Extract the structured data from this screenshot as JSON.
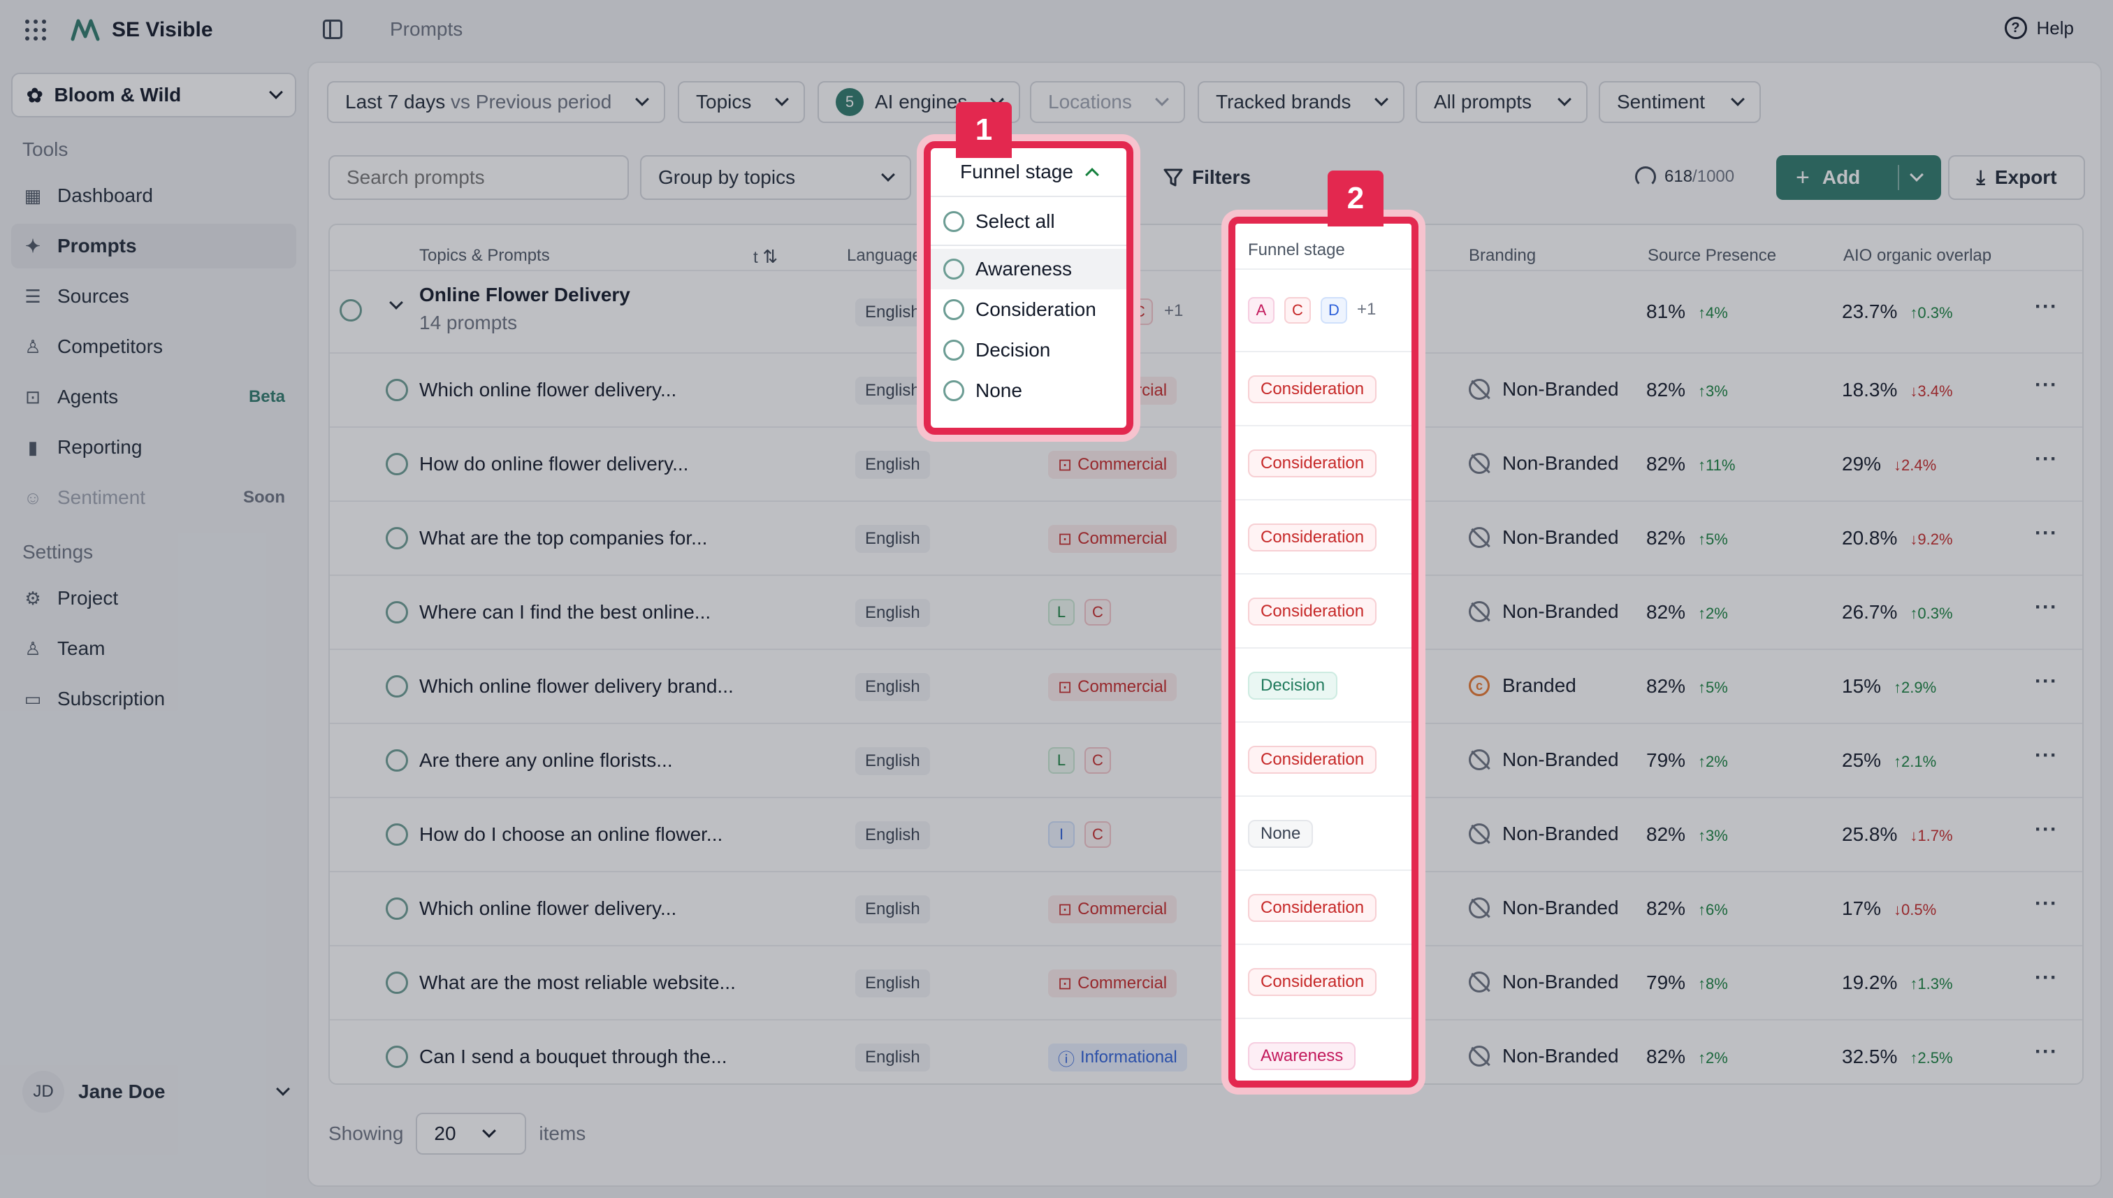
{
  "app": {
    "title": "SE Visible",
    "breadcrumb": "Prompts",
    "help": "Help"
  },
  "sidebar": {
    "workspace": "Bloom & Wild",
    "tools_label": "Tools",
    "settings_label": "Settings",
    "tools": [
      {
        "label": "Dashboard",
        "icon": "grid-icon"
      },
      {
        "label": "Prompts",
        "icon": "sparkle-icon",
        "active": true
      },
      {
        "label": "Sources",
        "icon": "list-icon"
      },
      {
        "label": "Competitors",
        "icon": "user-icon"
      },
      {
        "label": "Agents",
        "icon": "robot-icon",
        "badge": "Beta"
      },
      {
        "label": "Reporting",
        "icon": "bar-chart-icon"
      },
      {
        "label": "Sentiment",
        "icon": "smile-icon",
        "badge": "Soon"
      }
    ],
    "settings": [
      {
        "label": "Project",
        "icon": "gear-icon"
      },
      {
        "label": "Team",
        "icon": "users-icon"
      },
      {
        "label": "Subscription",
        "icon": "card-icon"
      }
    ],
    "user": {
      "initials": "JD",
      "name": "Jane Doe"
    }
  },
  "filters": {
    "period": "Last 7 days",
    "period_compare": "vs Previous period",
    "topics": "Topics",
    "engines_count": "5",
    "engines": "AI engines",
    "locations": "Locations",
    "tracked_brands": "Tracked brands",
    "all_prompts": "All prompts",
    "sentiment": "Sentiment"
  },
  "toolbar": {
    "search_placeholder": "Search prompts",
    "group_by": "Group by topics",
    "funnel_stage": "Funnel stage",
    "filters": "Filters",
    "quota_used": "618",
    "quota_max": "/1000",
    "add": "Add",
    "export": "Export"
  },
  "dropdown": {
    "select_all": "Select all",
    "options": [
      "Awareness",
      "Consideration",
      "Decision",
      "None"
    ]
  },
  "markers": {
    "one": "1",
    "two": "2"
  },
  "table": {
    "headers": {
      "topics": "Topics & Prompts",
      "intent_fragment": "t",
      "language": "Language",
      "funnel": "Funnel stage",
      "branding": "Branding",
      "source_presence": "Source Presence",
      "aio_overlap": "AIO organic overlap"
    },
    "group": {
      "title": "Online Flower Delivery",
      "subtitle": "14 prompts",
      "language": "English",
      "intent_tags": [
        "C",
        "+1"
      ],
      "funnel_tags": [
        "A",
        "C",
        "D"
      ],
      "funnel_more": "+1",
      "source": "81%",
      "source_delta": "4%",
      "source_dir": "up",
      "aio": "23.7%",
      "aio_delta": "0.3%",
      "aio_dir": "up"
    },
    "rows": [
      {
        "prompt": "Which online flower delivery...",
        "language": "English",
        "intent": "Commercial",
        "intent_type": "commercial",
        "funnel": "Consideration",
        "branding": "Non-Branded",
        "source": "82%",
        "source_delta": "3%",
        "source_dir": "up",
        "aio": "18.3%",
        "aio_delta": "3.4%",
        "aio_dir": "down"
      },
      {
        "prompt": "How do online flower delivery...",
        "language": "English",
        "intent": "Commercial",
        "intent_type": "commercial",
        "funnel": "Consideration",
        "branding": "Non-Branded",
        "source": "82%",
        "source_delta": "11%",
        "source_dir": "up",
        "aio": "29%",
        "aio_delta": "2.4%",
        "aio_dir": "down"
      },
      {
        "prompt": "What are the top companies for...",
        "language": "English",
        "intent": "Commercial",
        "intent_type": "commercial",
        "funnel": "Consideration",
        "branding": "Non-Branded",
        "source": "82%",
        "source_delta": "5%",
        "source_dir": "up",
        "aio": "20.8%",
        "aio_delta": "9.2%",
        "aio_dir": "down"
      },
      {
        "prompt": "Where can I find the best online...",
        "language": "English",
        "intent_tags": [
          "L",
          "C"
        ],
        "funnel": "Consideration",
        "branding": "Non-Branded",
        "source": "82%",
        "source_delta": "2%",
        "source_dir": "up",
        "aio": "26.7%",
        "aio_delta": "0.3%",
        "aio_dir": "up"
      },
      {
        "prompt": "Which online flower delivery brand...",
        "language": "English",
        "intent": "Commercial",
        "intent_type": "commercial",
        "funnel": "Decision",
        "branding": "Branded",
        "source": "82%",
        "source_delta": "5%",
        "source_dir": "up",
        "aio": "15%",
        "aio_delta": "2.9%",
        "aio_dir": "up"
      },
      {
        "prompt": "Are there any online florists...",
        "language": "English",
        "intent_tags": [
          "L",
          "C"
        ],
        "funnel": "Consideration",
        "branding": "Non-Branded",
        "source": "79%",
        "source_delta": "2%",
        "source_dir": "up",
        "aio": "25%",
        "aio_delta": "2.1%",
        "aio_dir": "up"
      },
      {
        "prompt": "How do I choose an online flower...",
        "language": "English",
        "intent_tags": [
          "I",
          "C"
        ],
        "funnel": "None",
        "branding": "Non-Branded",
        "source": "82%",
        "source_delta": "3%",
        "source_dir": "up",
        "aio": "25.8%",
        "aio_delta": "1.7%",
        "aio_dir": "down"
      },
      {
        "prompt": "Which online flower delivery...",
        "language": "English",
        "intent": "Commercial",
        "intent_type": "commercial",
        "funnel": "Consideration",
        "branding": "Non-Branded",
        "source": "82%",
        "source_delta": "6%",
        "source_dir": "up",
        "aio": "17%",
        "aio_delta": "0.5%",
        "aio_dir": "down"
      },
      {
        "prompt": "What are the most reliable website...",
        "language": "English",
        "intent": "Commercial",
        "intent_type": "commercial",
        "funnel": "Consideration",
        "branding": "Non-Branded",
        "source": "79%",
        "source_delta": "8%",
        "source_dir": "up",
        "aio": "19.2%",
        "aio_delta": "1.3%",
        "aio_dir": "up"
      },
      {
        "prompt": "Can I send a bouquet through the...",
        "language": "English",
        "intent": "Informational",
        "intent_type": "informational",
        "funnel": "Awareness",
        "branding": "Non-Branded",
        "source": "82%",
        "source_delta": "2%",
        "source_dir": "up",
        "aio": "32.5%",
        "aio_delta": "2.5%",
        "aio_dir": "up"
      }
    ]
  },
  "footer": {
    "showing": "Showing",
    "page_size": "20",
    "items": "items"
  },
  "colors": {
    "accent": "#2f7a6c",
    "highlight": "#e3284f",
    "up": "#15803d",
    "down": "#c62828"
  }
}
